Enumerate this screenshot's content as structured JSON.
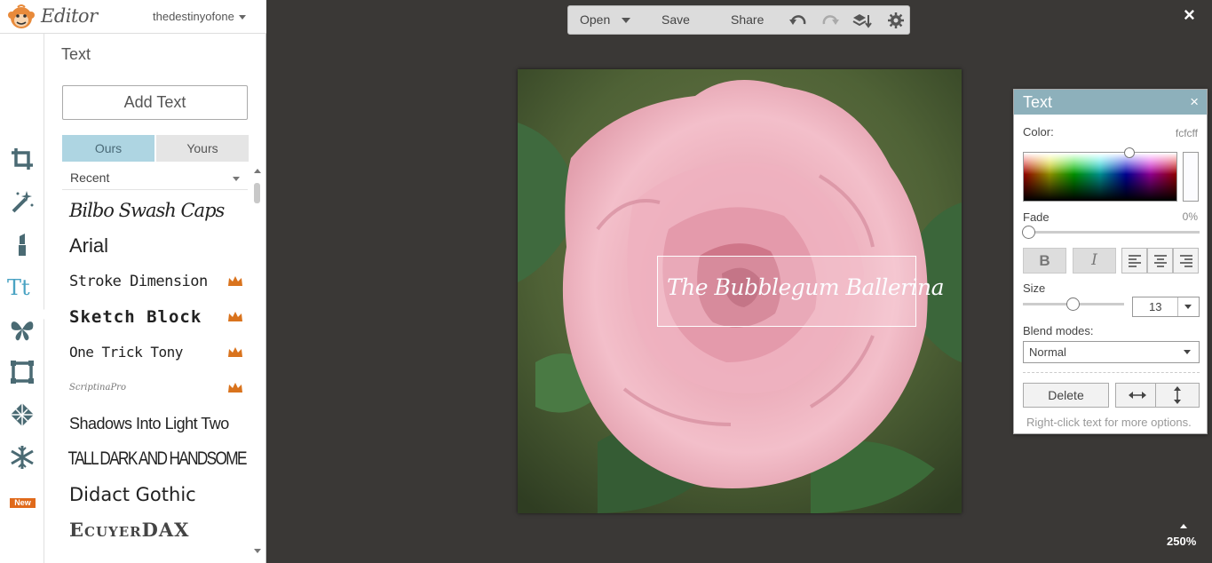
{
  "app": {
    "title": "Editor",
    "user": "thedestinyofone",
    "close_label": "×"
  },
  "sidebar": {
    "panel_title": "Text",
    "add_text_label": "Add Text",
    "tabs": [
      {
        "label": "Ours",
        "active": true
      },
      {
        "label": "Yours",
        "active": false
      }
    ],
    "filter_selected": "Recent",
    "new_badge": "New",
    "fonts": [
      {
        "name": "Bilbo Swash Caps",
        "premium": false
      },
      {
        "name": "Arial",
        "premium": false
      },
      {
        "name": "Stroke Dimension",
        "premium": true
      },
      {
        "name": "Sketch Block",
        "premium": true
      },
      {
        "name": "One Trick Tony",
        "premium": true
      },
      {
        "name": "ScriptinaPro",
        "premium": true
      },
      {
        "name": "Shadows Into Light Two",
        "premium": false
      },
      {
        "name": "TALL DARK AND HANDSOME",
        "premium": false
      },
      {
        "name": "Didact Gothic",
        "premium": false
      },
      {
        "name": "EcuyerDAX",
        "premium": false
      }
    ]
  },
  "toolbar": {
    "open_label": "Open",
    "save_label": "Save",
    "share_label": "Share"
  },
  "canvas": {
    "overlay_text": "The Bubblegum Ballerina",
    "zoom": "250%"
  },
  "text_panel": {
    "title": "Text",
    "close_label": "×",
    "color_label": "Color:",
    "color_value": "fcfcff",
    "fade_label": "Fade",
    "fade_value": "0%",
    "bold_label": "B",
    "italic_label": "I",
    "size_label": "Size",
    "size_value": "13",
    "blend_label": "Blend modes:",
    "blend_value": "Normal",
    "delete_label": "Delete",
    "hint": "Right-click text for more options."
  },
  "colors": {
    "accent": "#8db0bb",
    "tab_active": "#aed5e2",
    "crown": "#d9731d",
    "text_color": "#fcfcff"
  }
}
